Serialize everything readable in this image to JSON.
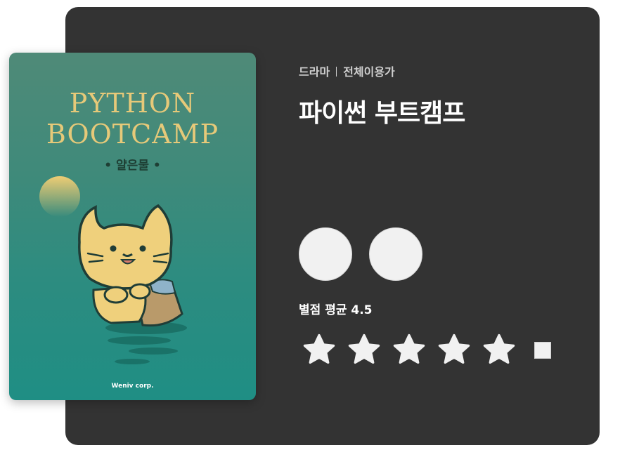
{
  "poster": {
    "title_line1": "PYTHON",
    "title_line2": "BOOTCAMP",
    "author": "• 얄은물 •",
    "publisher": "Weniv corp."
  },
  "details": {
    "genre": "드라마",
    "age_rating": "전체이용가",
    "title": "파이썬 부트캠프"
  },
  "buttons": [
    {
      "label": ""
    },
    {
      "label": ""
    }
  ],
  "rating": {
    "label": "별점 평균 4.5",
    "average": 4.5,
    "max": 5
  },
  "colors": {
    "card_bg": "#333333",
    "poster_title": "#e6c979",
    "star_fill": "#f1f1f1"
  }
}
